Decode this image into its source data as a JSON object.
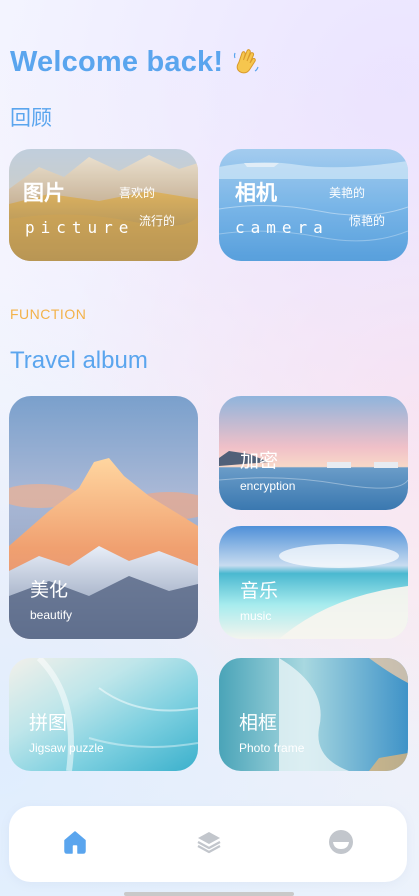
{
  "header": {
    "welcome": "Welcome back!",
    "wave_icon": "waving-hand-icon",
    "review_title": "回顾",
    "function_label": "FUNCTION",
    "album_title": "Travel album"
  },
  "review_cards": [
    {
      "title": "图片",
      "tag1": "喜欢的",
      "tag2": "流行的",
      "subtitle": "picture"
    },
    {
      "title": "相机",
      "tag1": "美艳的",
      "tag2": "惊艳的",
      "subtitle": "camera"
    }
  ],
  "function_cards": [
    {
      "cn": "美化",
      "en": "beautify"
    },
    {
      "cn": "加密",
      "en": "encryption"
    },
    {
      "cn": "音乐",
      "en": "music"
    },
    {
      "cn": "拼图",
      "en": "Jigsaw puzzle"
    },
    {
      "cn": "相框",
      "en": "Photo frame"
    }
  ],
  "nav": {
    "items": [
      {
        "icon": "home-icon",
        "active": true
      },
      {
        "icon": "layers-icon",
        "active": false
      },
      {
        "icon": "profile-icon",
        "active": false
      }
    ],
    "active_color": "#5aa5ee",
    "inactive_color": "#c2c6cc"
  },
  "colors": {
    "accent": "#5aa5ee",
    "function_label": "#f3b24a"
  }
}
